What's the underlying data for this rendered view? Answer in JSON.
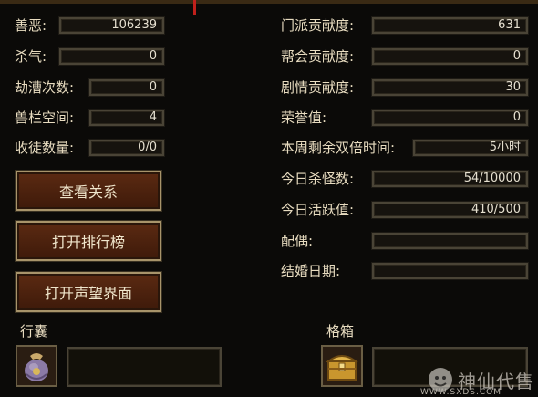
{
  "left_stats": [
    {
      "label": "善恶:",
      "value": "106239"
    },
    {
      "label": "杀气:",
      "value": "0"
    },
    {
      "label": "劫漕次数:",
      "value": "0"
    },
    {
      "label": "兽栏空间:",
      "value": "4"
    },
    {
      "label": "收徒数量:",
      "value": "0/0"
    }
  ],
  "right_stats": [
    {
      "label": "门派贡献度:",
      "value": "631"
    },
    {
      "label": "帮会贡献度:",
      "value": "0"
    },
    {
      "label": "剧情贡献度:",
      "value": "30"
    },
    {
      "label": "荣誉值:",
      "value": "0"
    },
    {
      "label": "本周剩余双倍时间:",
      "value": "5小时"
    },
    {
      "label": "今日杀怪数:",
      "value": "54/10000"
    },
    {
      "label": "今日活跃值:",
      "value": "410/500"
    },
    {
      "label": "配偶:",
      "value": ""
    },
    {
      "label": "结婚日期:",
      "value": ""
    }
  ],
  "buttons": {
    "view_relations": "查看关系",
    "open_ranking": "打开排行榜",
    "open_reputation": "打开声望界面"
  },
  "bag_label": "行囊",
  "box_label": "格箱",
  "watermark": {
    "text": "神仙代售",
    "url": "WWW.SXDS.COM"
  }
}
